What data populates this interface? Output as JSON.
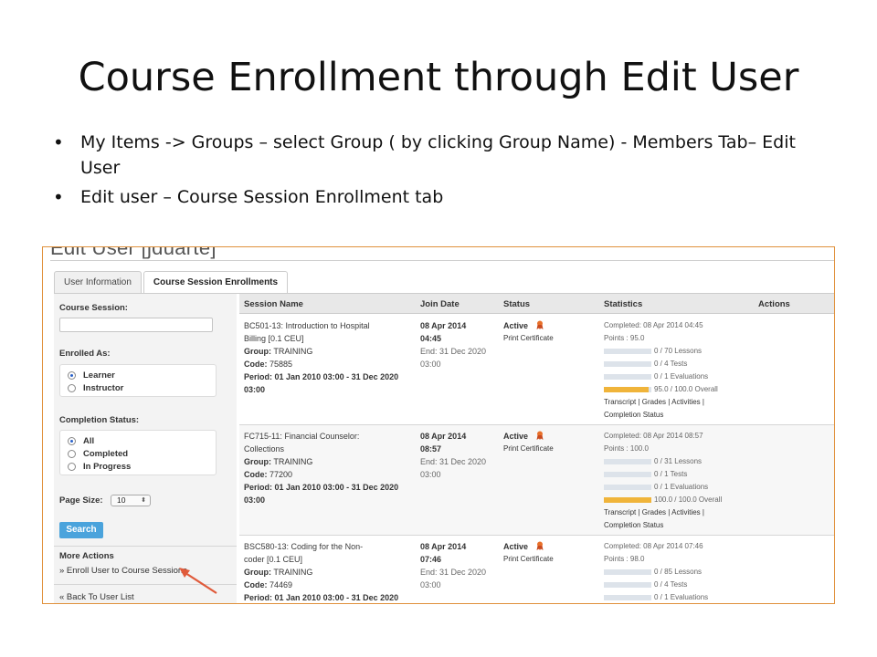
{
  "slide": {
    "title": "Course Enrollment through Edit User",
    "bullets": [
      "My Items -> Groups – select Group ( by clicking Group Name) - Members Tab– Edit User",
      "Edit user – Course Session Enrollment tab"
    ]
  },
  "screen": {
    "heading": "Edit User [jduarte]",
    "tabs": [
      "User Information",
      "Course Session Enrollments"
    ],
    "active_tab": "Course Session Enrollments",
    "sidebar": {
      "course_session_label": "Course Session:",
      "course_session_value": "",
      "enrolled_as_label": "Enrolled As:",
      "enrolled_as_options": [
        "Learner",
        "Instructor"
      ],
      "enrolled_as_selected": "Learner",
      "completion_label": "Completion Status:",
      "completion_options": [
        "All",
        "Completed",
        "In Progress"
      ],
      "completion_selected": "All",
      "page_size_label": "Page Size:",
      "page_size_value": "10",
      "search_button": "Search",
      "more_actions_label": "More Actions",
      "enroll_link": "» Enroll User to Course Sessions",
      "back_link": "« Back To User List"
    },
    "table": {
      "headers": [
        "Session Name",
        "Join Date",
        "Status",
        "Statistics",
        "Actions"
      ],
      "rows": [
        {
          "name_line1": "BC501-13: Introduction to Hospital",
          "name_line2": "Billing [0.1 CEU]",
          "group": "TRAINING",
          "code": "75885",
          "period": "01 Jan 2010 03:00 - 31 Dec 2020",
          "period_time": "03:00",
          "join_date": "08 Apr 2014",
          "join_time": "04:45",
          "end": "End: 31 Dec 2020",
          "end_time": "03:00",
          "status": "Active",
          "print": "Print Certificate",
          "completed": "Completed: 08 Apr 2014 04:45",
          "points": "Points : 95.0",
          "lessons": "0 / 70 Lessons",
          "tests": "0 / 4 Tests",
          "evaluations": "0 / 1 Evaluations",
          "overall": "95.0 / 100.0 Overall",
          "overall_fraction": 0.95
        },
        {
          "name_line1": "FC715-11: Financial Counselor:",
          "name_line2": "Collections",
          "group": "TRAINING",
          "code": "77200",
          "period": "01 Jan 2010 03:00 - 31 Dec 2020",
          "period_time": "03:00",
          "join_date": "08 Apr 2014",
          "join_time": "08:57",
          "end": "End: 31 Dec 2020",
          "end_time": "03:00",
          "status": "Active",
          "print": "Print Certificate",
          "completed": "Completed: 08 Apr 2014 08:57",
          "points": "Points : 100.0",
          "lessons": "0 / 31 Lessons",
          "tests": "0 / 1 Tests",
          "evaluations": "0 / 1 Evaluations",
          "overall": "100.0 / 100.0 Overall",
          "overall_fraction": 1.0
        },
        {
          "name_line1": "BSC580-13: Coding for the Non-",
          "name_line2": "coder [0.1 CEU]",
          "group": "TRAINING",
          "code": "74469",
          "period": "01 Jan 2010 03:00 - 31 Dec 2020",
          "period_time": "",
          "join_date": "08 Apr 2014",
          "join_time": "07:46",
          "end": "End: 31 Dec 2020",
          "end_time": "03:00",
          "status": "Active",
          "print": "Print Certificate",
          "completed": "Completed: 08 Apr 2014 07:46",
          "points": "Points : 98.0",
          "lessons": "0 / 85 Lessons",
          "tests": "0 / 4 Tests",
          "evaluations": "0 / 1 Evaluations",
          "overall": "",
          "overall_fraction": 0
        }
      ],
      "group_label": "Group:",
      "code_label": "Code:",
      "period_label": "Period:",
      "links_line1": "Transcript | Grades | Activities |",
      "links_line2": "Completion Status"
    },
    "colors": {
      "accent": "#4aa3dc",
      "frame": "#e0913c",
      "progress": "#f0b43a",
      "arrow": "#e05a3a"
    }
  }
}
